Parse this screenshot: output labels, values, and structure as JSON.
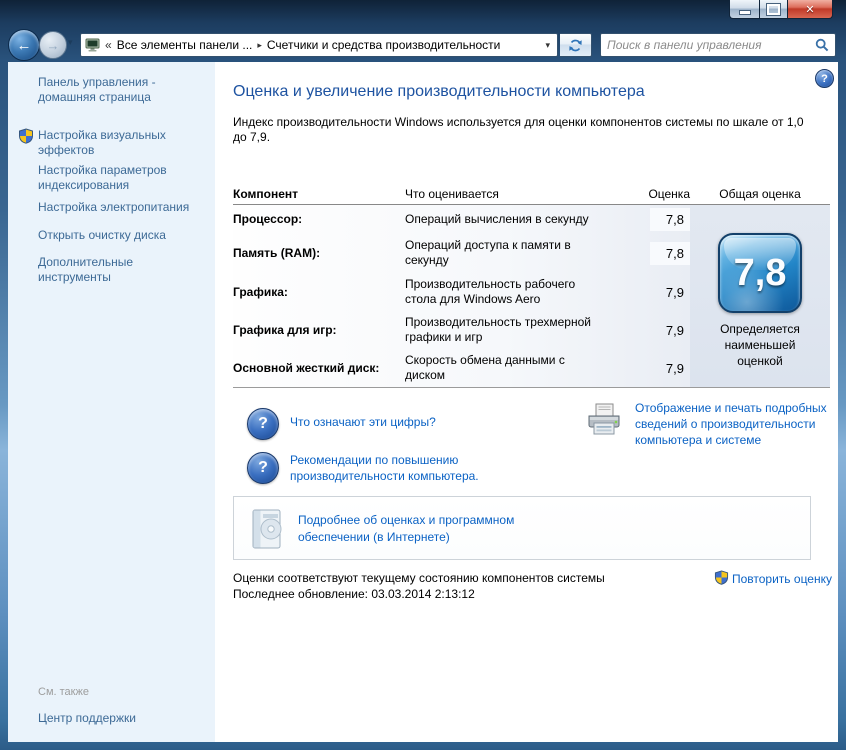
{
  "icons": {
    "back": "←",
    "forward": "→",
    "chevron_down": "▾",
    "breadcrumb_overflow": "«",
    "breadcrumb_sep": "▸",
    "close": "✕",
    "question": "?",
    "help": "?"
  },
  "navbar": {
    "breadcrumb": {
      "root": "Все элементы панели ...",
      "current": "Счетчики и средства производительности"
    },
    "search": {
      "placeholder": "Поиск в панели управления"
    }
  },
  "sidebar": {
    "home": "Панель управления -\nдомашняя страница",
    "items": [
      {
        "label": "Настройка визуальных\nэффектов"
      },
      {
        "label": "Настройка параметров\nиндексирования"
      },
      {
        "label": "Настройка электропитания"
      },
      {
        "label": "Открыть очистку диска"
      },
      {
        "label": "Дополнительные\nинструменты"
      }
    ],
    "see_also_header": "См. также",
    "see_also_items": [
      "Центр поддержки"
    ]
  },
  "main": {
    "title": "Оценка и увеличение производительности компьютера",
    "intro": "Индекс производительности Windows используется для оценки компонентов системы по шкале от 1,0\nдо 7,9.",
    "table": {
      "headers": [
        "Компонент",
        "Что оценивается",
        "Оценка",
        "Общая оценка"
      ],
      "rows": [
        {
          "component": "Процессор:",
          "desc": "Операций вычисления в секунду",
          "score": "7,8"
        },
        {
          "component": "Память (RAM):",
          "desc": "Операций доступа к памяти в\nсекунду",
          "score": "7,8"
        },
        {
          "component": "Графика:",
          "desc": "Производительность рабочего\nстола для Windows Aero",
          "score": "7,9"
        },
        {
          "component": "Графика для игр:",
          "desc": "Производительность трехмерной\nграфики и игр",
          "score": "7,9"
        },
        {
          "component": "Основной жесткий диск:",
          "desc": "Скорость обмена данными с\nдиском",
          "score": "7,9"
        }
      ],
      "base_score": "7,8",
      "base_score_caption": "Определяется\nнаименьшей\nоценкой"
    },
    "links": {
      "what_do_numbers_mean": "Что означают эти цифры?",
      "tips": "Рекомендации по повышению\nпроизводительности компьютера.",
      "print_details": "Отображение и печать подробных\nсведений о производительности\nкомпьютера и системе",
      "learn_more": "Подробнее об оценках и программном\nобеспечении (в Интернете)"
    },
    "status": {
      "line1": "Оценки соответствуют текущему состоянию компонентов системы",
      "line2": "Последнее обновление: 03.03.2014 2:13:12",
      "rerun": "Повторить оценку"
    }
  }
}
